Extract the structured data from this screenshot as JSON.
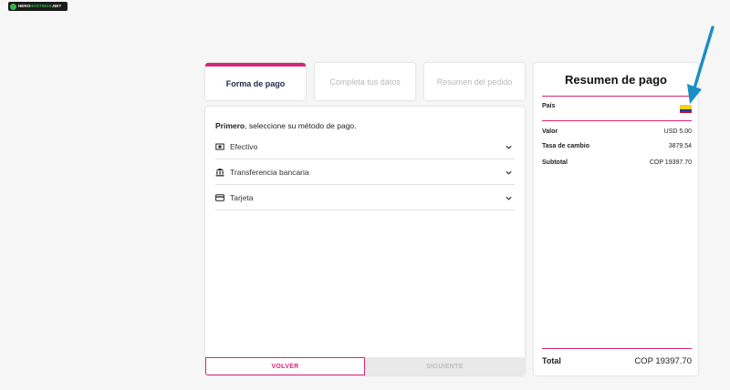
{
  "logo": {
    "text_a": "HERO",
    "text_b": "HOSTINGS",
    "text_c": ".NET"
  },
  "steps": [
    {
      "label": "Forma de pago",
      "active": true
    },
    {
      "label": "Completa tus datos",
      "active": false
    },
    {
      "label": "Resumen del pedido",
      "active": false
    }
  ],
  "payment": {
    "prompt_bold": "Primero",
    "prompt_rest": ", seleccione su método de pago.",
    "methods": [
      {
        "label": "Efectivo",
        "icon": "cash-icon"
      },
      {
        "label": "Transferencia bancaria",
        "icon": "bank-icon"
      },
      {
        "label": "Tarjeta",
        "icon": "card-icon"
      }
    ],
    "back_label": "VOLVER",
    "next_label": "SIGUIENTE"
  },
  "summary": {
    "title": "Resumen de pago",
    "country_label": "País",
    "country_flag": "colombia-flag-icon",
    "rows": [
      {
        "label": "Valor",
        "value": "USD 5.00"
      },
      {
        "label": "Tasa de cambio",
        "value": "3879.54"
      },
      {
        "label": "Subtotal",
        "value": "COP 19397.70"
      }
    ],
    "total_label": "Total",
    "total_value": "COP 19397.70"
  },
  "colors": {
    "accent": "#d6267c",
    "annotation_arrow": "#1a8fc2",
    "background": "#f6f6f6"
  }
}
